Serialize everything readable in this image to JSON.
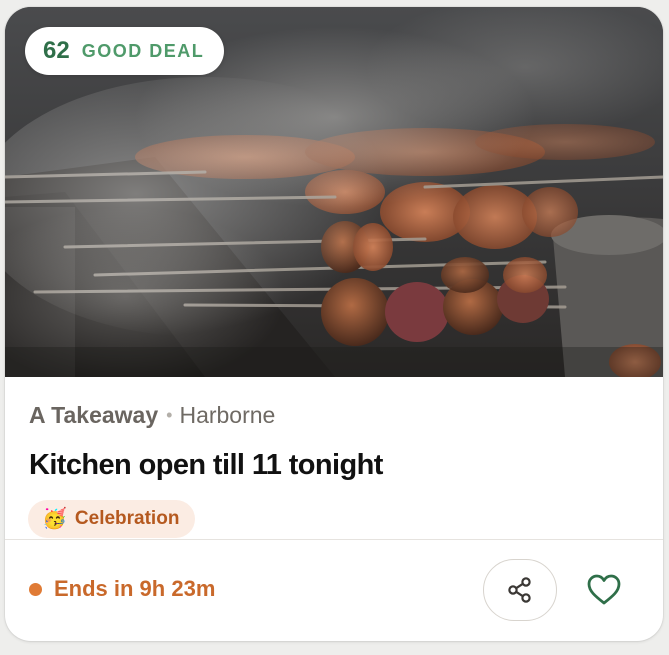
{
  "deal": {
    "score": "62",
    "label": "GOOD DEAL"
  },
  "listing": {
    "venue": "A Takeaway",
    "separator": "•",
    "area": "Harborne",
    "title": "Kitchen open till 11 tonight",
    "tag": {
      "emoji": "🥳",
      "label": "Celebration"
    },
    "status": "Ends in 9h 23m"
  },
  "icons": {
    "share": "share-icon",
    "favourite": "heart-icon"
  },
  "colors": {
    "deal_score": "#2f6f49",
    "deal_label": "#4f9a6a",
    "tag_bg": "#fbece3",
    "tag_text": "#b5591f",
    "status": "#c9692b",
    "heart": "#2f6f49"
  }
}
